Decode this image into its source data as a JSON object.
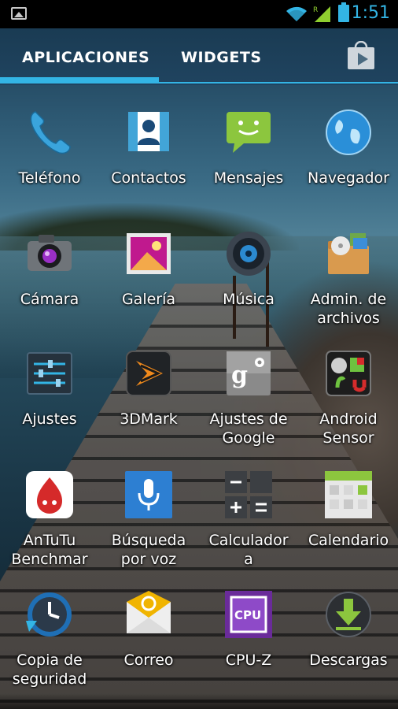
{
  "status_bar": {
    "time": "1:51",
    "roaming_indicator": "R",
    "accent_color": "#33b5e5",
    "icons": [
      "picture-notification-icon",
      "wifi-icon",
      "signal-icon",
      "battery-icon"
    ]
  },
  "tabs": {
    "apps_label": "APLICACIONES",
    "widgets_label": "WIDGETS",
    "selected": "APLICACIONES",
    "store_icon": "play-store-icon"
  },
  "apps": [
    {
      "label": "Teléfono",
      "icon": "phone-icon"
    },
    {
      "label": "Contactos",
      "icon": "contacts-icon"
    },
    {
      "label": "Mensajes",
      "icon": "messages-icon"
    },
    {
      "label": "Navegador",
      "icon": "browser-icon"
    },
    {
      "label": "Cámara",
      "icon": "camera-icon"
    },
    {
      "label": "Galería",
      "icon": "gallery-icon"
    },
    {
      "label": "Música",
      "icon": "music-icon"
    },
    {
      "label": "Admin. de\narchivos",
      "icon": "file-manager-icon"
    },
    {
      "label": "Ajustes",
      "icon": "settings-icon"
    },
    {
      "label": "3DMark",
      "icon": "3dmark-icon"
    },
    {
      "label": "Ajustes de\nGoogle",
      "icon": "google-settings-icon"
    },
    {
      "label": "Android\nSensor",
      "icon": "android-sensor-icon"
    },
    {
      "label": "AnTuTu\nBenchmar",
      "icon": "antutu-icon"
    },
    {
      "label": "Búsqueda\npor voz",
      "icon": "voice-search-icon"
    },
    {
      "label": "Calculador\na",
      "icon": "calculator-icon"
    },
    {
      "label": "Calendario",
      "icon": "calendar-icon"
    },
    {
      "label": "Copia de\nseguridad",
      "icon": "backup-icon"
    },
    {
      "label": "Correo",
      "icon": "email-icon"
    },
    {
      "label": "CPU-Z",
      "icon": "cpu-z-icon"
    },
    {
      "label": "Descargas",
      "icon": "downloads-icon"
    }
  ]
}
